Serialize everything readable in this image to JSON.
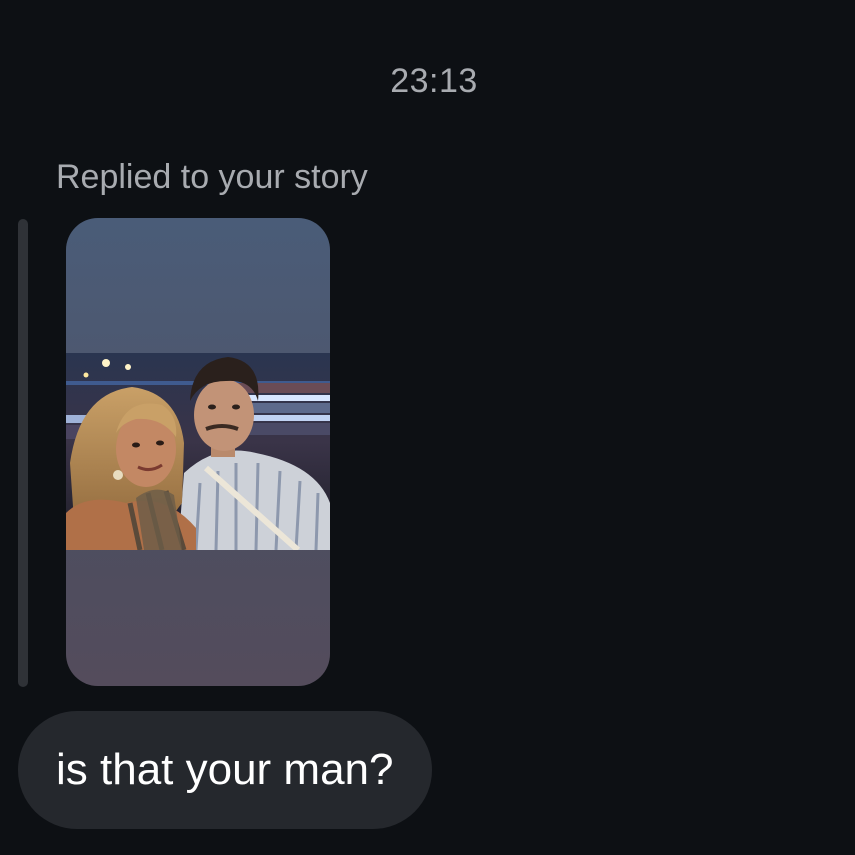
{
  "thread": {
    "timestamp": "23:13",
    "reply_label": "Replied to your story",
    "story": {
      "thumbnail": "selfie-photo-concert-arena"
    },
    "message": {
      "text": "is that your man?"
    }
  },
  "colors": {
    "background": "#0d1014",
    "secondary_text": "#a8abb0",
    "bubble": "#25282d",
    "reply_bar": "#2f3237"
  }
}
